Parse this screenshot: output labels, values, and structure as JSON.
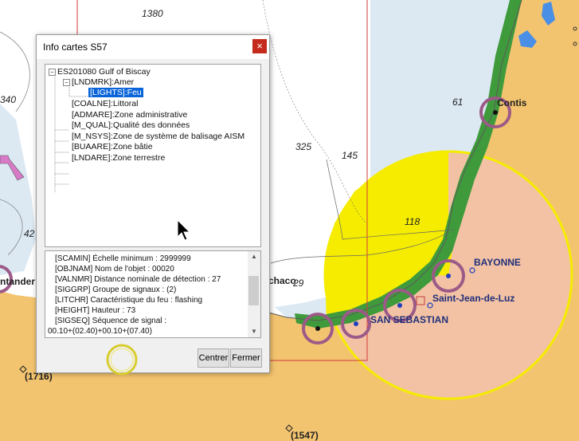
{
  "dialog": {
    "title": "Info cartes S57",
    "close_symbol": "×",
    "tree": {
      "root": "ES201080  Gulf of Biscay",
      "landmark": "[LNDMRK]:Amer",
      "lights": "[LIGHTS]:Feu",
      "items": [
        "[COALNE]:Littoral",
        "[ADMARE]:Zone administrative",
        "[M_QUAL]:Qualité des données",
        "[M_NSYS]:Zone de système de balisage AISM",
        "[BUAARE]:Zone bâtie",
        "[LNDARE]:Zone terrestre"
      ]
    },
    "attributes": [
      "[SCAMIN] Échelle minimum : 2999999",
      "[OBJNAM] Nom de l'objet : 00020",
      "[VALNMR] Distance nominale de détection : 27",
      "[SIGGRP] Groupe de signaux : (2)",
      "[LITCHR] Caractéristique du feu : flashing",
      "[HEIGHT] Hauteur : 73",
      "[SIGSEQ] Séquence de signal :",
      "00.10+(02.40)+00.10+(07.40)"
    ],
    "center_button": "Centrer",
    "close_button": "Fermer"
  },
  "map": {
    "depths": [
      "1380",
      "340",
      "42",
      "325",
      "145",
      "61",
      "118",
      "29",
      "(1716)",
      "(1547)"
    ],
    "places": {
      "contis": "Contis",
      "bayonne": "BAYONNE",
      "saint_jean": "Saint-Jean-de-Luz",
      "san_sebastian": "SAN SEBASTIAN",
      "chaco_partial": "chaco",
      "santander_partial": "ntander"
    },
    "colors": {
      "land": "#f3c46f",
      "deep_water": "#ffffff",
      "shallow_water": "#dce9f3",
      "light_sector": "#f5ec00",
      "light_range_fill": "#f3c2a4",
      "coast_green": "#3f9a3c",
      "light_symbol": "#9c5a88",
      "chart_limit": "#d33a3a"
    }
  }
}
